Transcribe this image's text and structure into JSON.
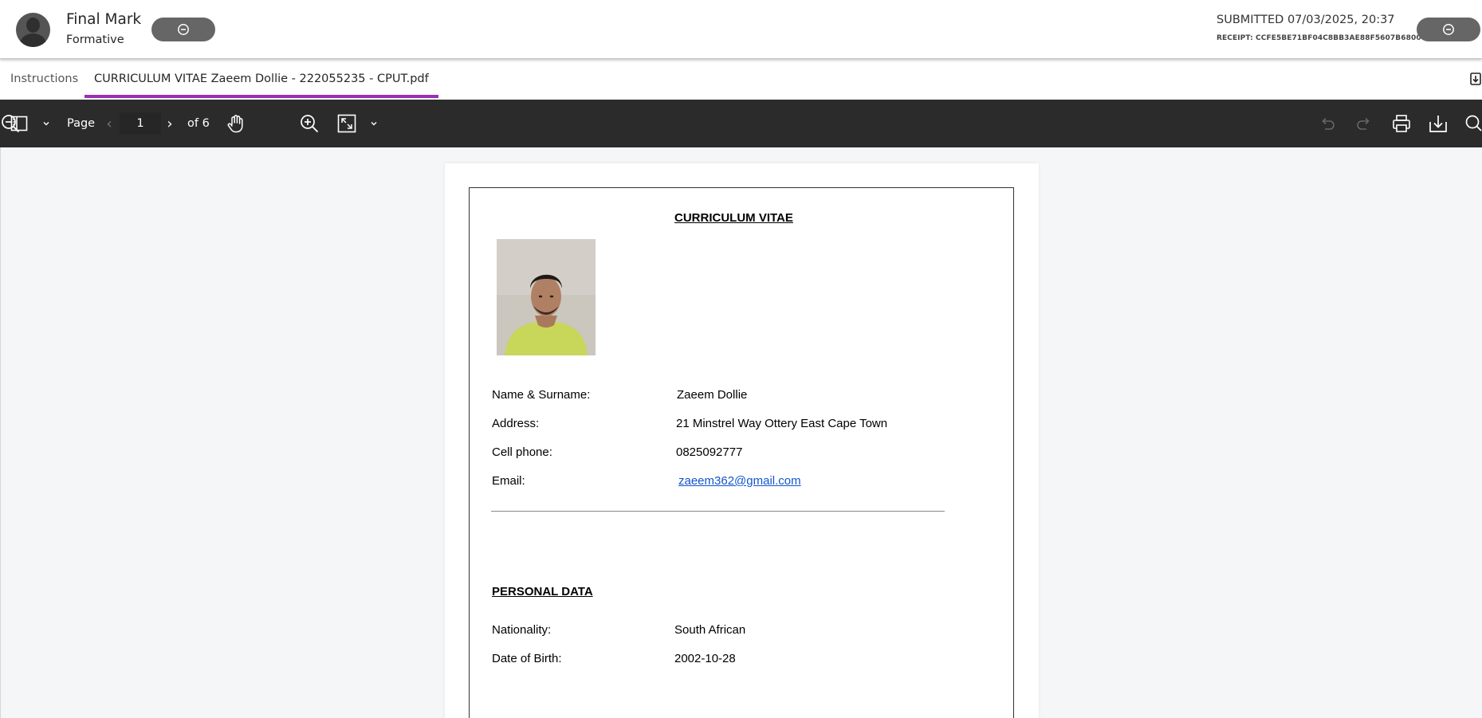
{
  "header": {
    "title": "Final Mark",
    "subtitle": "Formative",
    "submitted": "SUBMITTED 07/03/2025, 20:37",
    "receipt": "RECEIPT: CCFE5BE71BF04C8BB3AE88F5607B6800"
  },
  "tabs": [
    {
      "label": "Instructions",
      "active": false
    },
    {
      "label": "CURRICULUM VITAE Zaeem Dollie - 222055235 - CPUT.pdf",
      "active": true
    }
  ],
  "toolbar": {
    "page_label": "Page",
    "page_value": "1",
    "of_label": "of 6",
    "prev": "‹",
    "next": "›"
  },
  "document": {
    "title": "CURRICULUM VITAE",
    "fields": [
      {
        "label": "Name & Surname:",
        "value": "Zaeem Dollie"
      },
      {
        "label": "Address:",
        "value": "21 Minstrel Way Ottery East Cape Town"
      },
      {
        "label": "Cell phone:",
        "value": "0825092777"
      },
      {
        "label": "Email:",
        "value": "zaeem362@gmail.com"
      }
    ],
    "section_title": "PERSONAL DATA",
    "personal": [
      {
        "label": "Nationality:",
        "value": "South African"
      },
      {
        "label": "Date of Birth:",
        "value": "2002-10-28"
      }
    ]
  },
  "colors": {
    "tab_accent": "#9a2fb5",
    "toolbar_bg": "#2b2b2b",
    "link": "#1155cc"
  }
}
